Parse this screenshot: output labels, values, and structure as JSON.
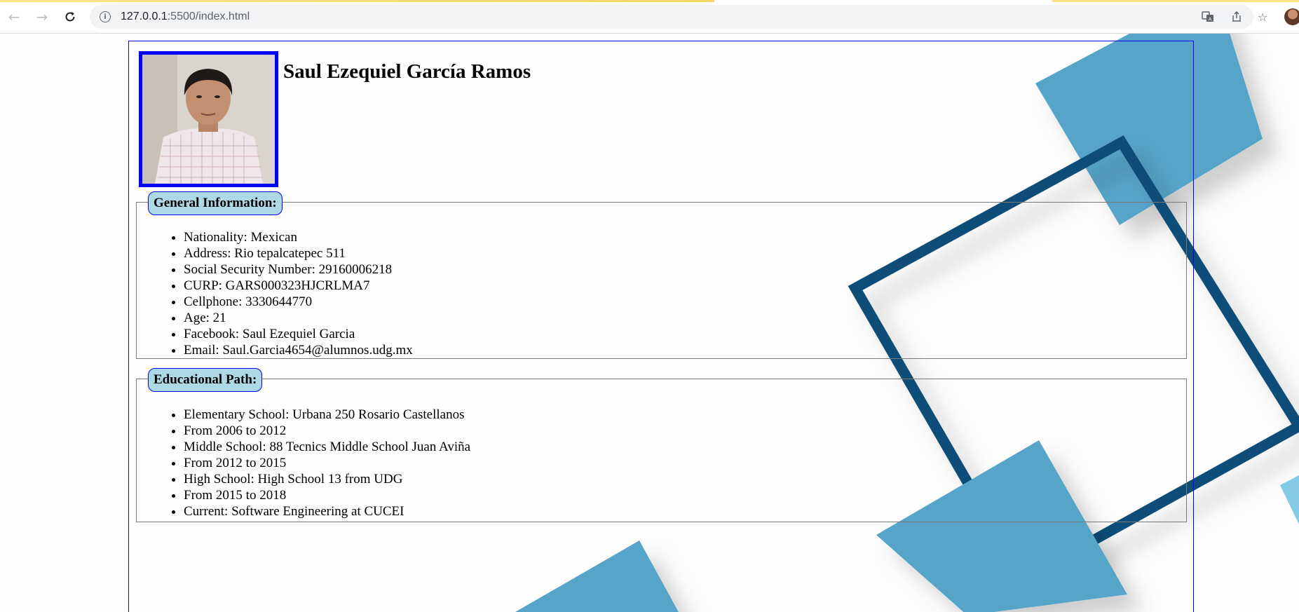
{
  "browser": {
    "url_host": "127.0.0.1",
    "url_rest": ":5500/index.html"
  },
  "profile": {
    "name": "Saul Ezequiel García Ramos"
  },
  "general": {
    "legend": "General Information:",
    "items": [
      "Nationality: Mexican",
      "Address: Rio tepalcatepec 511",
      "Social Security Number: 29160006218",
      "CURP: GARS000323HJCRLMA7",
      "Cellphone: 3330644770",
      "Age: 21",
      "Facebook: Saul Ezequiel Garcia",
      "Email: Saul.Garcia4654@alumnos.udg.mx"
    ]
  },
  "education": {
    "legend": "Educational Path:",
    "items": [
      "Elementary School: Urbana 250 Rosario Castellanos",
      "From 2006 to 2012",
      "Middle School: 88 Tecnics Middle School Juan Aviña",
      "From 2012 to 2015",
      "High School: High School 13 from UDG",
      "From 2015 to 2018",
      "Current: Software Engineering at CUCEI"
    ]
  },
  "colors": {
    "frame_blue": "#0000ff",
    "legend_fill": "#add8e6",
    "art_light": "#56a5c9",
    "art_dark": "#0f4d78"
  }
}
